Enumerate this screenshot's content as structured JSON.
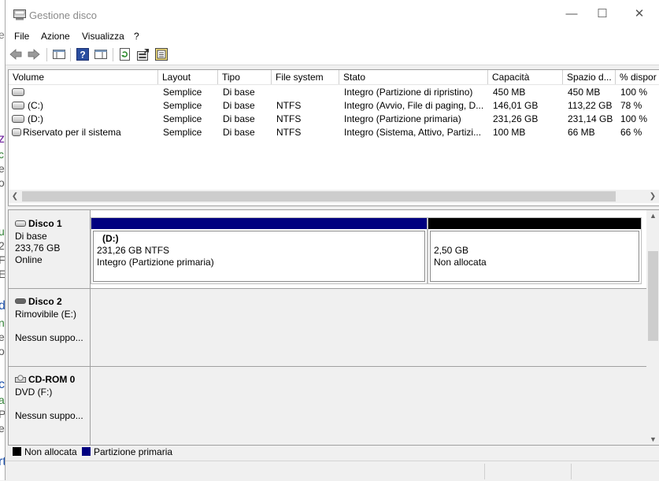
{
  "background": {
    "fragments": [
      "ed",
      "z",
      "c",
      "e",
      "or",
      "u",
      "20",
      "F",
      "E",
      "d",
      "n",
      "el",
      "or",
      "c",
      "a",
      "P",
      "e",
      "rt"
    ]
  },
  "window": {
    "title": "Gestione disco",
    "minimize": "—",
    "maximize": "☐",
    "close": "✕"
  },
  "menu": [
    "File",
    "Azione",
    "Visualizza",
    "?"
  ],
  "columns": [
    "Volume",
    "Layout",
    "Tipo",
    "File system",
    "Stato",
    "Capacità",
    "Spazio d...",
    "% dispor"
  ],
  "volumes": [
    {
      "volume": "",
      "layout": "Semplice",
      "type": "Di base",
      "fs": "",
      "status": "Integro (Partizione di ripristino)",
      "capacity": "450 MB",
      "free": "450 MB",
      "pct": "100 %"
    },
    {
      "volume": "(C:)",
      "layout": "Semplice",
      "type": "Di base",
      "fs": "NTFS",
      "status": "Integro (Avvio, File di paging, D...",
      "capacity": "146,01 GB",
      "free": "113,22 GB",
      "pct": "78 %"
    },
    {
      "volume": "(D:)",
      "layout": "Semplice",
      "type": "Di base",
      "fs": "NTFS",
      "status": "Integro (Partizione primaria)",
      "capacity": "231,26 GB",
      "free": "231,14 GB",
      "pct": "100 %"
    },
    {
      "volume": "Riservato per il sistema",
      "layout": "Semplice",
      "type": "Di base",
      "fs": "NTFS",
      "status": "Integro (Sistema, Attivo, Partizi...",
      "capacity": "100 MB",
      "free": "66 MB",
      "pct": "66 %"
    }
  ],
  "disks": [
    {
      "name": "Disco 1",
      "line1": "Di base",
      "line2": "233,76 GB",
      "line3": "Online"
    },
    {
      "name": "Disco 2",
      "line1": "Rimovibile (E:)",
      "line2": "",
      "line3": "Nessun suppo..."
    },
    {
      "name": "CD-ROM 0",
      "line1": "DVD (F:)",
      "line2": "",
      "line3": "Nessun suppo..."
    }
  ],
  "partitions": [
    {
      "title": "(D:)",
      "size": "231,26 GB NTFS",
      "status": "Integro (Partizione primaria)",
      "color": "#000080"
    },
    {
      "title": "",
      "size": "2,50 GB",
      "status": "Non allocata",
      "color": "#000000"
    }
  ],
  "legend": [
    {
      "label": "Non allocata",
      "color": "#000000"
    },
    {
      "label": "Partizione primaria",
      "color": "#000080"
    }
  ]
}
